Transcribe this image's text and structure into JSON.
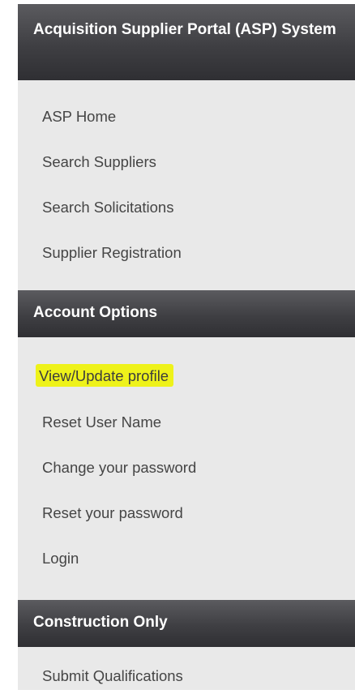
{
  "sections": [
    {
      "title": "Acquisition Supplier Portal (ASP) System",
      "items": [
        {
          "label": "ASP Home"
        },
        {
          "label": "Search Suppliers"
        },
        {
          "label": "Search Solicitations"
        },
        {
          "label": "Supplier Registration"
        }
      ]
    },
    {
      "title": "Account Options",
      "items": [
        {
          "label": "View/Update profile",
          "highlighted": true,
          "highlight_color": "#eef21a"
        },
        {
          "label": "Reset User Name"
        },
        {
          "label": "Change your password"
        },
        {
          "label": "Reset your password"
        },
        {
          "label": "Login"
        }
      ]
    },
    {
      "title": "Construction Only",
      "items": [
        {
          "label": "Submit Qualifications"
        }
      ]
    }
  ]
}
